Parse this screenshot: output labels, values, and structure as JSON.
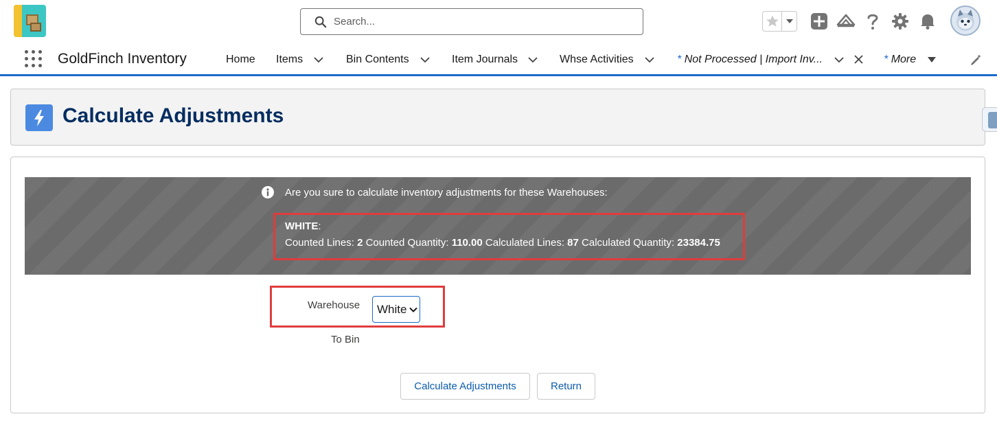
{
  "search": {
    "placeholder": "Search..."
  },
  "nav": {
    "app_name": "GoldFinch Inventory",
    "items": [
      {
        "label": "Home"
      },
      {
        "label": "Items"
      },
      {
        "label": "Bin Contents"
      },
      {
        "label": "Item Journals"
      },
      {
        "label": "Whse Activities"
      },
      {
        "label": "Not Processed | Import Inv..."
      },
      {
        "label": "More"
      }
    ],
    "modified_marker": "*"
  },
  "page": {
    "title": "Calculate Adjustments"
  },
  "alert": {
    "message": "Are you sure to calculate inventory adjustments for these Warehouses:",
    "warehouse_name": "WHITE",
    "warehouse_suffix": ":",
    "counted_lines_label": "Counted Lines:",
    "counted_lines": "2",
    "counted_quantity_label": "Counted Quantity:",
    "counted_quantity": "110.00",
    "calculated_lines_label": "Calculated Lines:",
    "calculated_lines": "87",
    "calculated_quantity_label": "Calculated Quantity:",
    "calculated_quantity": "23384.75"
  },
  "form": {
    "warehouse_label": "Warehouse",
    "warehouse_value": "White",
    "to_bin_label": "To Bin"
  },
  "buttons": {
    "calculate": "Calculate Adjustments",
    "return": "Return"
  },
  "colors": {
    "brand_blue": "#1b6ac9",
    "title_navy": "#032d60",
    "highlight_red": "#e03c3c",
    "alert_gray": "#6b6b6b"
  },
  "icons": [
    "app-logo",
    "search-icon",
    "favorite-star-icon",
    "chevron-down-icon",
    "add-icon",
    "trailhead-icon",
    "help-icon",
    "settings-gear-icon",
    "notification-bell-icon",
    "avatar",
    "app-launcher-icon",
    "close-icon",
    "edit-pencil-icon",
    "lightning-icon",
    "info-icon"
  ]
}
